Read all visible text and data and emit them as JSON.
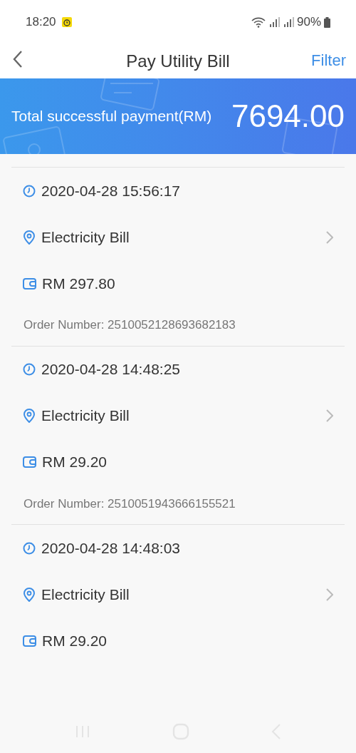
{
  "status_bar": {
    "time": "18:20",
    "battery": "90%"
  },
  "header": {
    "title": "Pay Utility Bill",
    "action": "Filter"
  },
  "summary": {
    "label": "Total successful payment(RM)",
    "amount": "7694.00"
  },
  "records": [
    {
      "time": "2020-04-28 15:56:17",
      "bill": "Electricity Bill",
      "amount": "RM 297.80",
      "order_number": "Order Number: 2510052128693682183"
    },
    {
      "time": "2020-04-28 14:48:25",
      "bill": "Electricity Bill",
      "amount": "RM 29.20",
      "order_number": "Order Number: 2510051943666155521"
    },
    {
      "time": "2020-04-28 14:48:03",
      "bill": "Electricity Bill",
      "amount": "RM 29.20"
    }
  ]
}
